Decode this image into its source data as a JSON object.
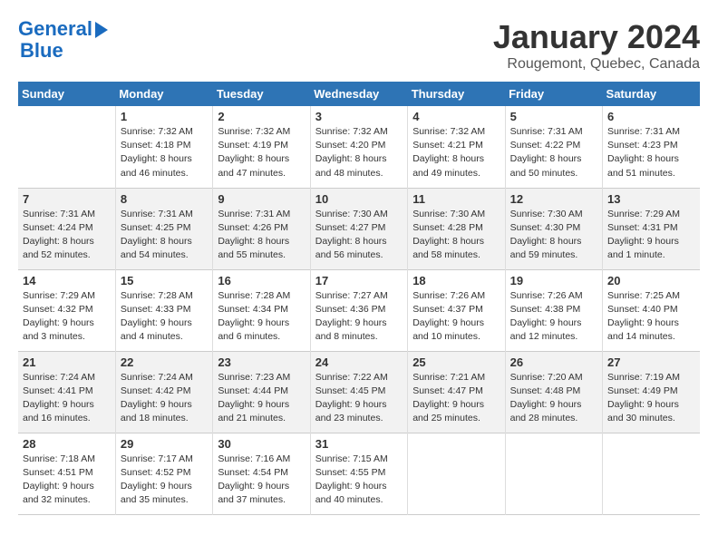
{
  "header": {
    "logo_line1": "General",
    "logo_line2": "Blue",
    "title": "January 2024",
    "subtitle": "Rougemont, Quebec, Canada"
  },
  "days_of_week": [
    "Sunday",
    "Monday",
    "Tuesday",
    "Wednesday",
    "Thursday",
    "Friday",
    "Saturday"
  ],
  "weeks": [
    [
      {
        "day": "",
        "info": ""
      },
      {
        "day": "1",
        "info": "Sunrise: 7:32 AM\nSunset: 4:18 PM\nDaylight: 8 hours\nand 46 minutes."
      },
      {
        "day": "2",
        "info": "Sunrise: 7:32 AM\nSunset: 4:19 PM\nDaylight: 8 hours\nand 47 minutes."
      },
      {
        "day": "3",
        "info": "Sunrise: 7:32 AM\nSunset: 4:20 PM\nDaylight: 8 hours\nand 48 minutes."
      },
      {
        "day": "4",
        "info": "Sunrise: 7:32 AM\nSunset: 4:21 PM\nDaylight: 8 hours\nand 49 minutes."
      },
      {
        "day": "5",
        "info": "Sunrise: 7:31 AM\nSunset: 4:22 PM\nDaylight: 8 hours\nand 50 minutes."
      },
      {
        "day": "6",
        "info": "Sunrise: 7:31 AM\nSunset: 4:23 PM\nDaylight: 8 hours\nand 51 minutes."
      }
    ],
    [
      {
        "day": "7",
        "info": "Sunrise: 7:31 AM\nSunset: 4:24 PM\nDaylight: 8 hours\nand 52 minutes."
      },
      {
        "day": "8",
        "info": "Sunrise: 7:31 AM\nSunset: 4:25 PM\nDaylight: 8 hours\nand 54 minutes."
      },
      {
        "day": "9",
        "info": "Sunrise: 7:31 AM\nSunset: 4:26 PM\nDaylight: 8 hours\nand 55 minutes."
      },
      {
        "day": "10",
        "info": "Sunrise: 7:30 AM\nSunset: 4:27 PM\nDaylight: 8 hours\nand 56 minutes."
      },
      {
        "day": "11",
        "info": "Sunrise: 7:30 AM\nSunset: 4:28 PM\nDaylight: 8 hours\nand 58 minutes."
      },
      {
        "day": "12",
        "info": "Sunrise: 7:30 AM\nSunset: 4:30 PM\nDaylight: 8 hours\nand 59 minutes."
      },
      {
        "day": "13",
        "info": "Sunrise: 7:29 AM\nSunset: 4:31 PM\nDaylight: 9 hours\nand 1 minute."
      }
    ],
    [
      {
        "day": "14",
        "info": "Sunrise: 7:29 AM\nSunset: 4:32 PM\nDaylight: 9 hours\nand 3 minutes."
      },
      {
        "day": "15",
        "info": "Sunrise: 7:28 AM\nSunset: 4:33 PM\nDaylight: 9 hours\nand 4 minutes."
      },
      {
        "day": "16",
        "info": "Sunrise: 7:28 AM\nSunset: 4:34 PM\nDaylight: 9 hours\nand 6 minutes."
      },
      {
        "day": "17",
        "info": "Sunrise: 7:27 AM\nSunset: 4:36 PM\nDaylight: 9 hours\nand 8 minutes."
      },
      {
        "day": "18",
        "info": "Sunrise: 7:26 AM\nSunset: 4:37 PM\nDaylight: 9 hours\nand 10 minutes."
      },
      {
        "day": "19",
        "info": "Sunrise: 7:26 AM\nSunset: 4:38 PM\nDaylight: 9 hours\nand 12 minutes."
      },
      {
        "day": "20",
        "info": "Sunrise: 7:25 AM\nSunset: 4:40 PM\nDaylight: 9 hours\nand 14 minutes."
      }
    ],
    [
      {
        "day": "21",
        "info": "Sunrise: 7:24 AM\nSunset: 4:41 PM\nDaylight: 9 hours\nand 16 minutes."
      },
      {
        "day": "22",
        "info": "Sunrise: 7:24 AM\nSunset: 4:42 PM\nDaylight: 9 hours\nand 18 minutes."
      },
      {
        "day": "23",
        "info": "Sunrise: 7:23 AM\nSunset: 4:44 PM\nDaylight: 9 hours\nand 21 minutes."
      },
      {
        "day": "24",
        "info": "Sunrise: 7:22 AM\nSunset: 4:45 PM\nDaylight: 9 hours\nand 23 minutes."
      },
      {
        "day": "25",
        "info": "Sunrise: 7:21 AM\nSunset: 4:47 PM\nDaylight: 9 hours\nand 25 minutes."
      },
      {
        "day": "26",
        "info": "Sunrise: 7:20 AM\nSunset: 4:48 PM\nDaylight: 9 hours\nand 28 minutes."
      },
      {
        "day": "27",
        "info": "Sunrise: 7:19 AM\nSunset: 4:49 PM\nDaylight: 9 hours\nand 30 minutes."
      }
    ],
    [
      {
        "day": "28",
        "info": "Sunrise: 7:18 AM\nSunset: 4:51 PM\nDaylight: 9 hours\nand 32 minutes."
      },
      {
        "day": "29",
        "info": "Sunrise: 7:17 AM\nSunset: 4:52 PM\nDaylight: 9 hours\nand 35 minutes."
      },
      {
        "day": "30",
        "info": "Sunrise: 7:16 AM\nSunset: 4:54 PM\nDaylight: 9 hours\nand 37 minutes."
      },
      {
        "day": "31",
        "info": "Sunrise: 7:15 AM\nSunset: 4:55 PM\nDaylight: 9 hours\nand 40 minutes."
      },
      {
        "day": "",
        "info": ""
      },
      {
        "day": "",
        "info": ""
      },
      {
        "day": "",
        "info": ""
      }
    ]
  ]
}
